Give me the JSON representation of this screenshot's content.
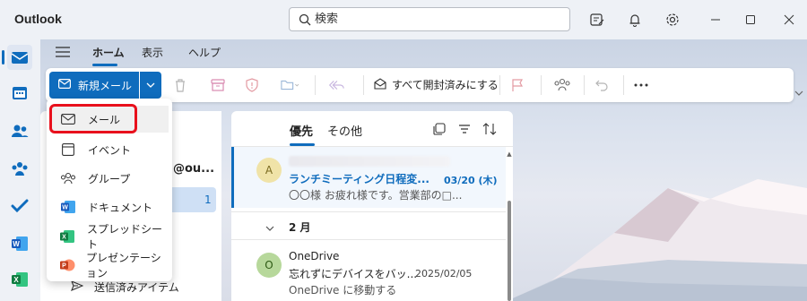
{
  "app": {
    "title": "Outlook"
  },
  "search": {
    "placeholder": "検索"
  },
  "menu_tabs": [
    "ホーム",
    "表示",
    "ヘルプ"
  ],
  "ribbon": {
    "new_mail_label": "新規メール",
    "mark_all_read_label": "すべて開封済みにする"
  },
  "new_menu": {
    "items": [
      {
        "label": "メール",
        "icon": "mail-icon"
      },
      {
        "label": "イベント",
        "icon": "calendar-icon"
      },
      {
        "label": "グループ",
        "icon": "group-icon"
      },
      {
        "label": "ドキュメント",
        "icon": "word-icon"
      },
      {
        "label": "スプレッドシート",
        "icon": "excel-icon"
      },
      {
        "label": "プレゼンテーション",
        "icon": "powerpoint-icon"
      }
    ]
  },
  "folder_pane": {
    "account_fragment": "@ou...",
    "selected_count": "1",
    "sent_items_label": "送信済みアイテム"
  },
  "message_list": {
    "pivots": [
      "優先",
      "その他"
    ],
    "messages": [
      {
        "avatar_letter": "A",
        "subject": "ランチミーティング日程変...",
        "date": "03/20 (木)",
        "preview": "〇〇様 お疲れ様です。営業部の□..."
      },
      {
        "avatar_letter": "O",
        "sender": "OneDrive",
        "subject": "忘れずにデバイスをバッ...",
        "date": "2025/02/05",
        "preview": "OneDrive に移動する"
      }
    ],
    "group_header": "2 月"
  },
  "colors": {
    "accent": "#0f6cbd",
    "highlight_box": "#e8101c",
    "avatar_a": "#f0e3a8",
    "avatar_o": "#b7d89b"
  }
}
